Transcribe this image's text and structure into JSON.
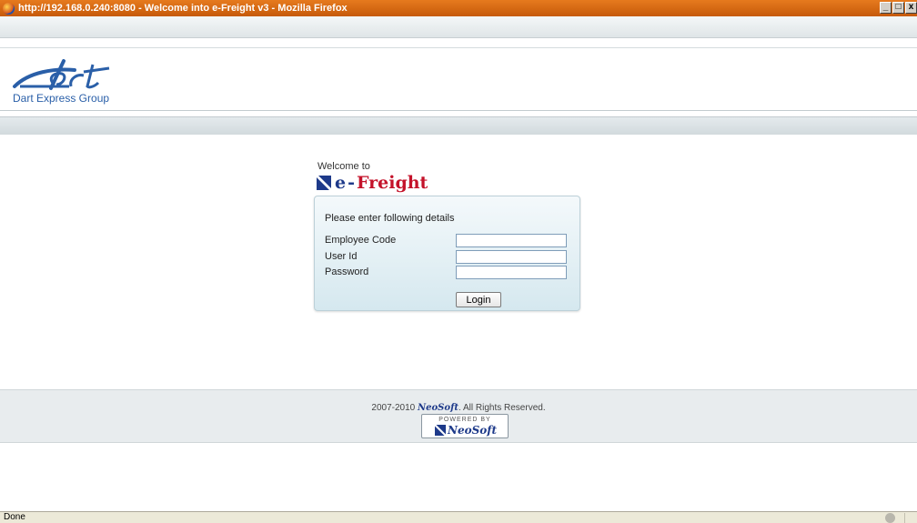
{
  "window": {
    "title": "http://192.168.0.240:8080 - Welcome into e-Freight v3 - Mozilla Firefox",
    "buttons": [
      "_",
      "□",
      "x"
    ]
  },
  "header": {
    "logo_alt": "dart",
    "company_name": "Dart Express Group"
  },
  "welcome": {
    "line1": "Welcome to",
    "brand_e": "e",
    "brand_dash": "-",
    "brand_freight": "Freight"
  },
  "login_form": {
    "intro": "Please enter following details",
    "employee_code_label": "Employee Code",
    "employee_code_value": "",
    "user_id_label": "User Id",
    "user_id_value": "",
    "password_label": "Password",
    "password_value": "",
    "login_button": "Login"
  },
  "footer": {
    "copyright_years": "2007-2010",
    "copyright_brand": "NeoSoft",
    "copyright_suffix": ". All Rights Reserved.",
    "powered_by": "POWERED BY",
    "powered_brand": "NeoSoft"
  },
  "statusbar": {
    "text": "Done"
  },
  "colors": {
    "brand_blue": "#1e3a8a",
    "brand_red": "#c4122a",
    "dart_blue": "#2a5fa8",
    "titlebar_orange": "#e67a1e"
  }
}
